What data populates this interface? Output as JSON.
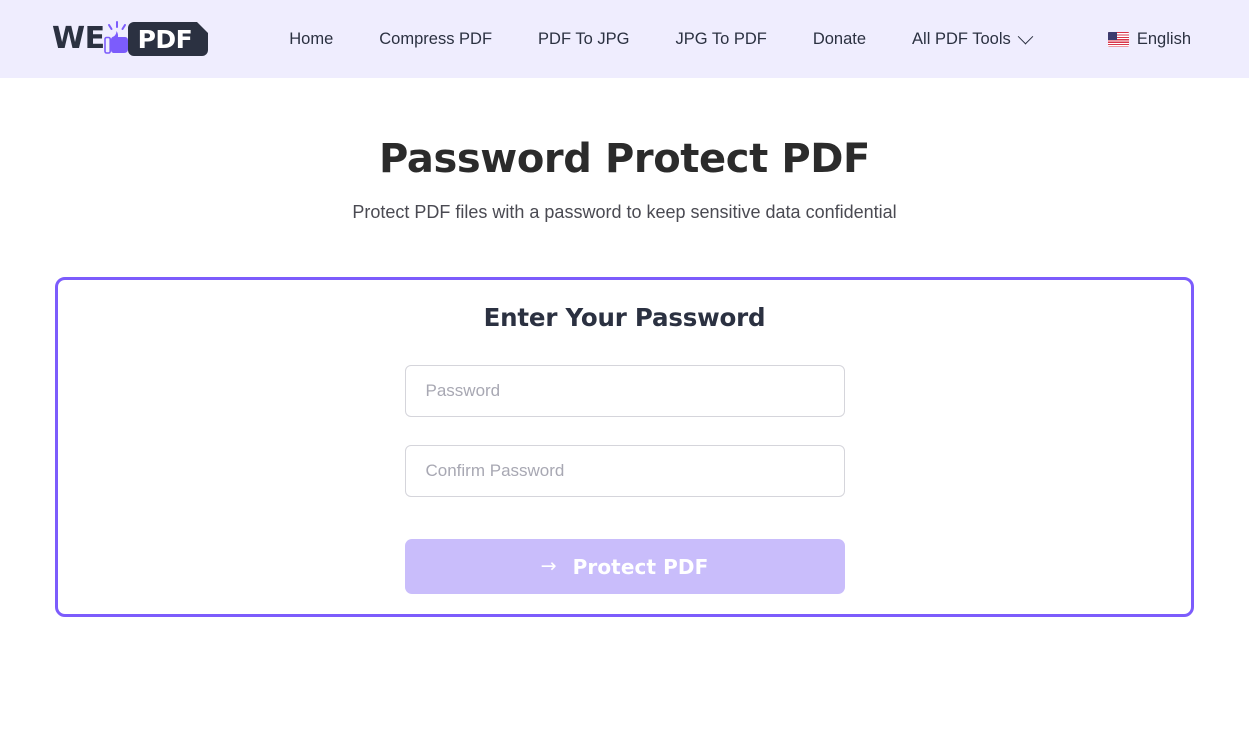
{
  "header": {
    "logo": {
      "text_left": "WE",
      "text_right": "PDF",
      "thumb_icon": "thumbs-up-icon"
    },
    "nav": [
      {
        "label": "Home",
        "has_chevron": false
      },
      {
        "label": "Compress PDF",
        "has_chevron": false
      },
      {
        "label": "PDF To JPG",
        "has_chevron": false
      },
      {
        "label": "JPG To PDF",
        "has_chevron": false
      },
      {
        "label": "Donate",
        "has_chevron": false
      },
      {
        "label": "All PDF Tools",
        "has_chevron": true
      }
    ],
    "language": {
      "label": "English",
      "flag_icon": "us-flag-icon"
    },
    "bg_color": "#efedfe"
  },
  "main": {
    "title": "Password Protect PDF",
    "subtitle": "Protect PDF files with a password to keep sensitive data confidential",
    "card": {
      "heading": "Enter Your Password",
      "border_color": "#7c5cfc",
      "password_value": "",
      "password_placeholder": "Password",
      "confirm_value": "",
      "confirm_placeholder": "Confirm Password",
      "submit_label": "Protect PDF",
      "submit_arrow": "→",
      "submit_color": "#c9bdfb"
    }
  }
}
